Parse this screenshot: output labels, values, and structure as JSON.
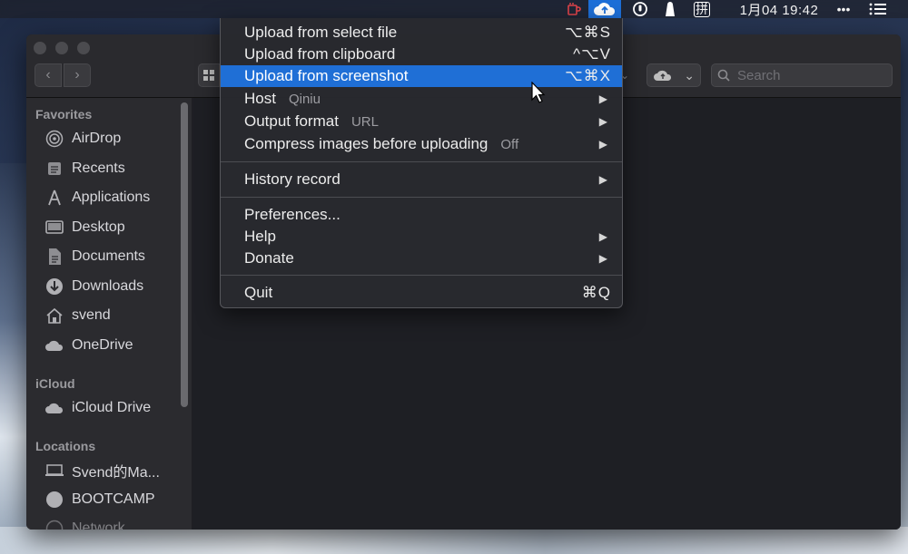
{
  "menubar": {
    "clock": "1月04 19:42",
    "input_method": "拼",
    "more": "•••",
    "icons": [
      "cup-icon",
      "cloud-upload-icon",
      "power-icon",
      "bookmark-icon",
      "input-method-icon",
      "more-icon",
      "menu-list-icon"
    ]
  },
  "menu": {
    "items": [
      {
        "label": "Upload from select file",
        "shortcut": "⌥⌘S"
      },
      {
        "label": "Upload from clipboard",
        "shortcut": "^⌥V"
      },
      {
        "label": "Upload from screenshot",
        "shortcut": "⌥⌘X",
        "highlighted": true
      },
      {
        "label": "Host",
        "value": "Qiniu",
        "submenu": true
      },
      {
        "label": "Output format",
        "value": "URL",
        "submenu": true
      },
      {
        "label": "Compress images before uploading",
        "value": "Off",
        "submenu": true
      },
      {
        "label": "History record",
        "submenu": true
      },
      {
        "label": "Preferences..."
      },
      {
        "label": "Help",
        "submenu": true
      },
      {
        "label": "Donate",
        "submenu": true
      },
      {
        "label": "Quit",
        "shortcut": "⌘Q"
      }
    ],
    "highlight_color": "#1f6fd6"
  },
  "toolbar": {
    "search_placeholder": "Search"
  },
  "sidebar": {
    "favorites_heading": "Favorites",
    "icloud_heading": "iCloud",
    "locations_heading": "Locations",
    "favorites": [
      {
        "label": "AirDrop",
        "icon": "airdrop-icon"
      },
      {
        "label": "Recents",
        "icon": "recents-icon"
      },
      {
        "label": "Applications",
        "icon": "applications-icon"
      },
      {
        "label": "Desktop",
        "icon": "desktop-icon"
      },
      {
        "label": "Documents",
        "icon": "documents-icon"
      },
      {
        "label": "Downloads",
        "icon": "downloads-icon"
      },
      {
        "label": "svend",
        "icon": "home-icon"
      },
      {
        "label": "OneDrive",
        "icon": "cloud-icon"
      }
    ],
    "icloud": [
      {
        "label": "iCloud Drive",
        "icon": "cloud-icon"
      }
    ],
    "locations": [
      {
        "label": "Svend的Ma...",
        "icon": "laptop-icon"
      },
      {
        "label": "BOOTCAMP",
        "icon": "disk-icon"
      },
      {
        "label": "Network",
        "icon": "network-icon"
      }
    ]
  }
}
